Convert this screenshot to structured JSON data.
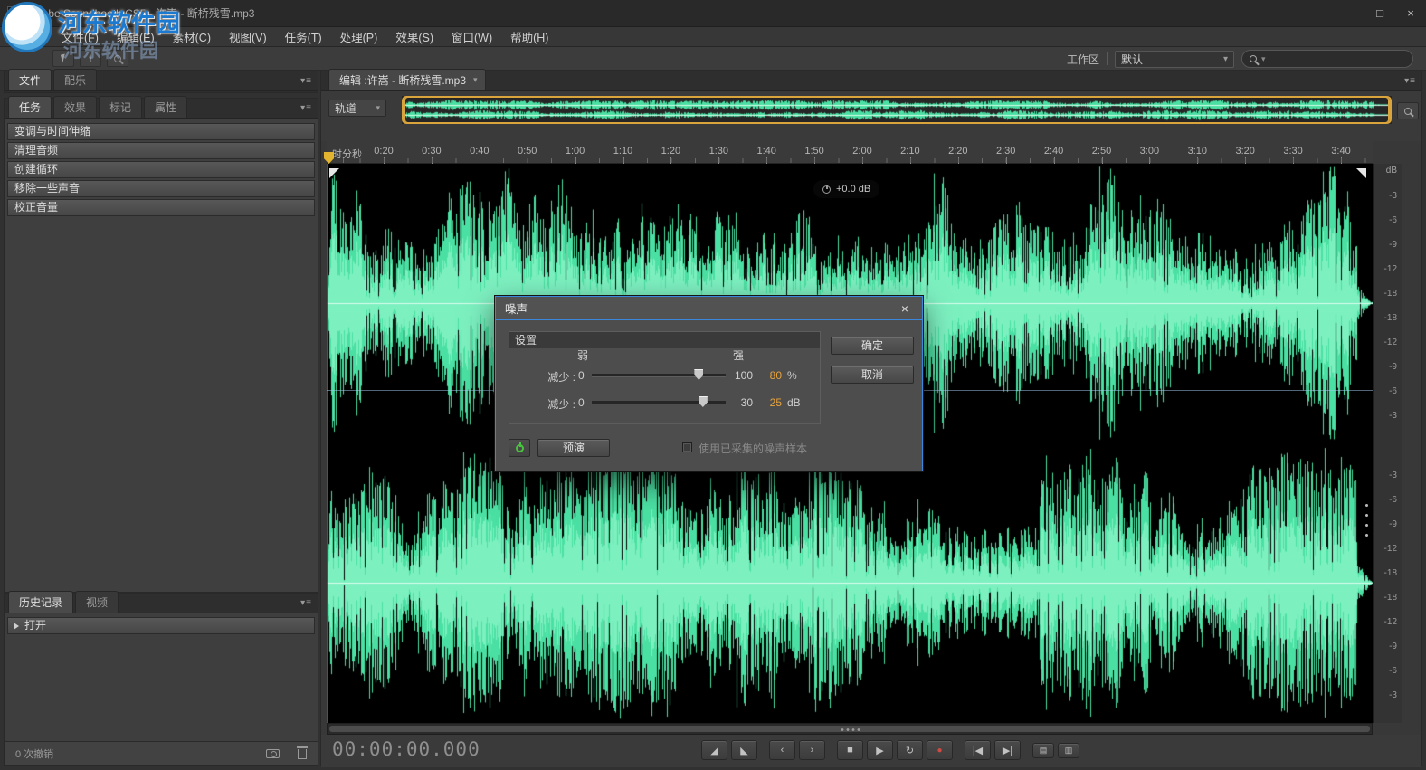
{
  "window": {
    "app_icon": "Sb",
    "title": "Adobe Soundbooth CS5 - 许嵩 - 断桥残雪.mp3",
    "minimize": "–",
    "maximize": "□",
    "close": "×"
  },
  "watermark": {
    "line1": "河东软件园",
    "line2": "河东软件园"
  },
  "menu": {
    "items": [
      "文件(F)",
      "编辑(E)",
      "素材(C)",
      "视图(V)",
      "任务(T)",
      "处理(P)",
      "效果(S)",
      "窗口(W)",
      "帮助(H)"
    ]
  },
  "toolbar": {
    "workspace_label": "工作区",
    "workspace_value": "默认"
  },
  "icons": {
    "dropdown_arrow": "▾",
    "panel_menu": "▾≡",
    "time_select_tool": "I"
  },
  "left": {
    "top_tabs": [
      "文件",
      "配乐"
    ],
    "task_tabs": [
      "任务",
      "效果",
      "标记",
      "属性"
    ],
    "tasks": [
      "变调与时间伸缩",
      "清理音频",
      "创建循环",
      "移除一些声音",
      "校正音量"
    ],
    "history_tabs": [
      "历史记录",
      "视频"
    ],
    "history_item": "打开",
    "undo_status": "0 次撤销"
  },
  "editor": {
    "tab_label": "编辑 :许嵩 - 断桥残雪.mp3",
    "track_label": "轨道",
    "ruler_unit": "时分秒",
    "ruler_ticks": [
      "0:20",
      "0:30",
      "0:40",
      "0:50",
      "1:00",
      "1:10",
      "1:20",
      "1:30",
      "1:40",
      "1:50",
      "2:00",
      "2:10",
      "2:20",
      "2:30",
      "2:40",
      "2:50",
      "3:00",
      "3:10",
      "3:20",
      "3:30",
      "3:40"
    ],
    "volume_hud": "+0.0 dB",
    "db_unit": "dB",
    "db_ticks": [
      "-3",
      "-6",
      "-9",
      "-12",
      "-18",
      "-18",
      "-12",
      "-9",
      "-6",
      "-3"
    ],
    "waveform_color": "#4be0a3",
    "selection_color": "#d9a43b"
  },
  "dialog": {
    "title": "噪声",
    "close": "×",
    "section_header": "设置",
    "weak": "弱",
    "strong": "强",
    "rows": [
      {
        "label": "减少 :",
        "min": "0",
        "max": "100",
        "value": "80",
        "unit": "%",
        "percent": 80
      },
      {
        "label": "减少 :",
        "min": "0",
        "max": "30",
        "value": "25",
        "unit": "dB",
        "percent": 83
      }
    ],
    "preview": "预演",
    "sample_checkbox": "使用已采集的噪声样本",
    "ok": "确定",
    "cancel": "取消"
  },
  "transport": {
    "timecode": "00:00:00.000",
    "groups": [
      [
        {
          "name": "fade-in-button",
          "glyph": "◢"
        },
        {
          "name": "fade-out-button",
          "glyph": "◣"
        }
      ],
      [
        {
          "name": "skip-back-button",
          "glyph": "‹"
        },
        {
          "name": "skip-forward-button",
          "glyph": "›"
        }
      ],
      [
        {
          "name": "stop-button",
          "glyph": "■"
        },
        {
          "name": "play-button",
          "glyph": "▶"
        },
        {
          "name": "loop-play-button",
          "glyph": "↻"
        },
        {
          "name": "record-button",
          "glyph": "●"
        }
      ],
      [
        {
          "name": "prev-marker-button",
          "glyph": "|◀"
        },
        {
          "name": "next-marker-button",
          "glyph": "▶|"
        }
      ],
      [
        {
          "name": "meter-a-button",
          "glyph": "▤"
        },
        {
          "name": "meter-b-button",
          "glyph": "▥"
        }
      ]
    ]
  }
}
